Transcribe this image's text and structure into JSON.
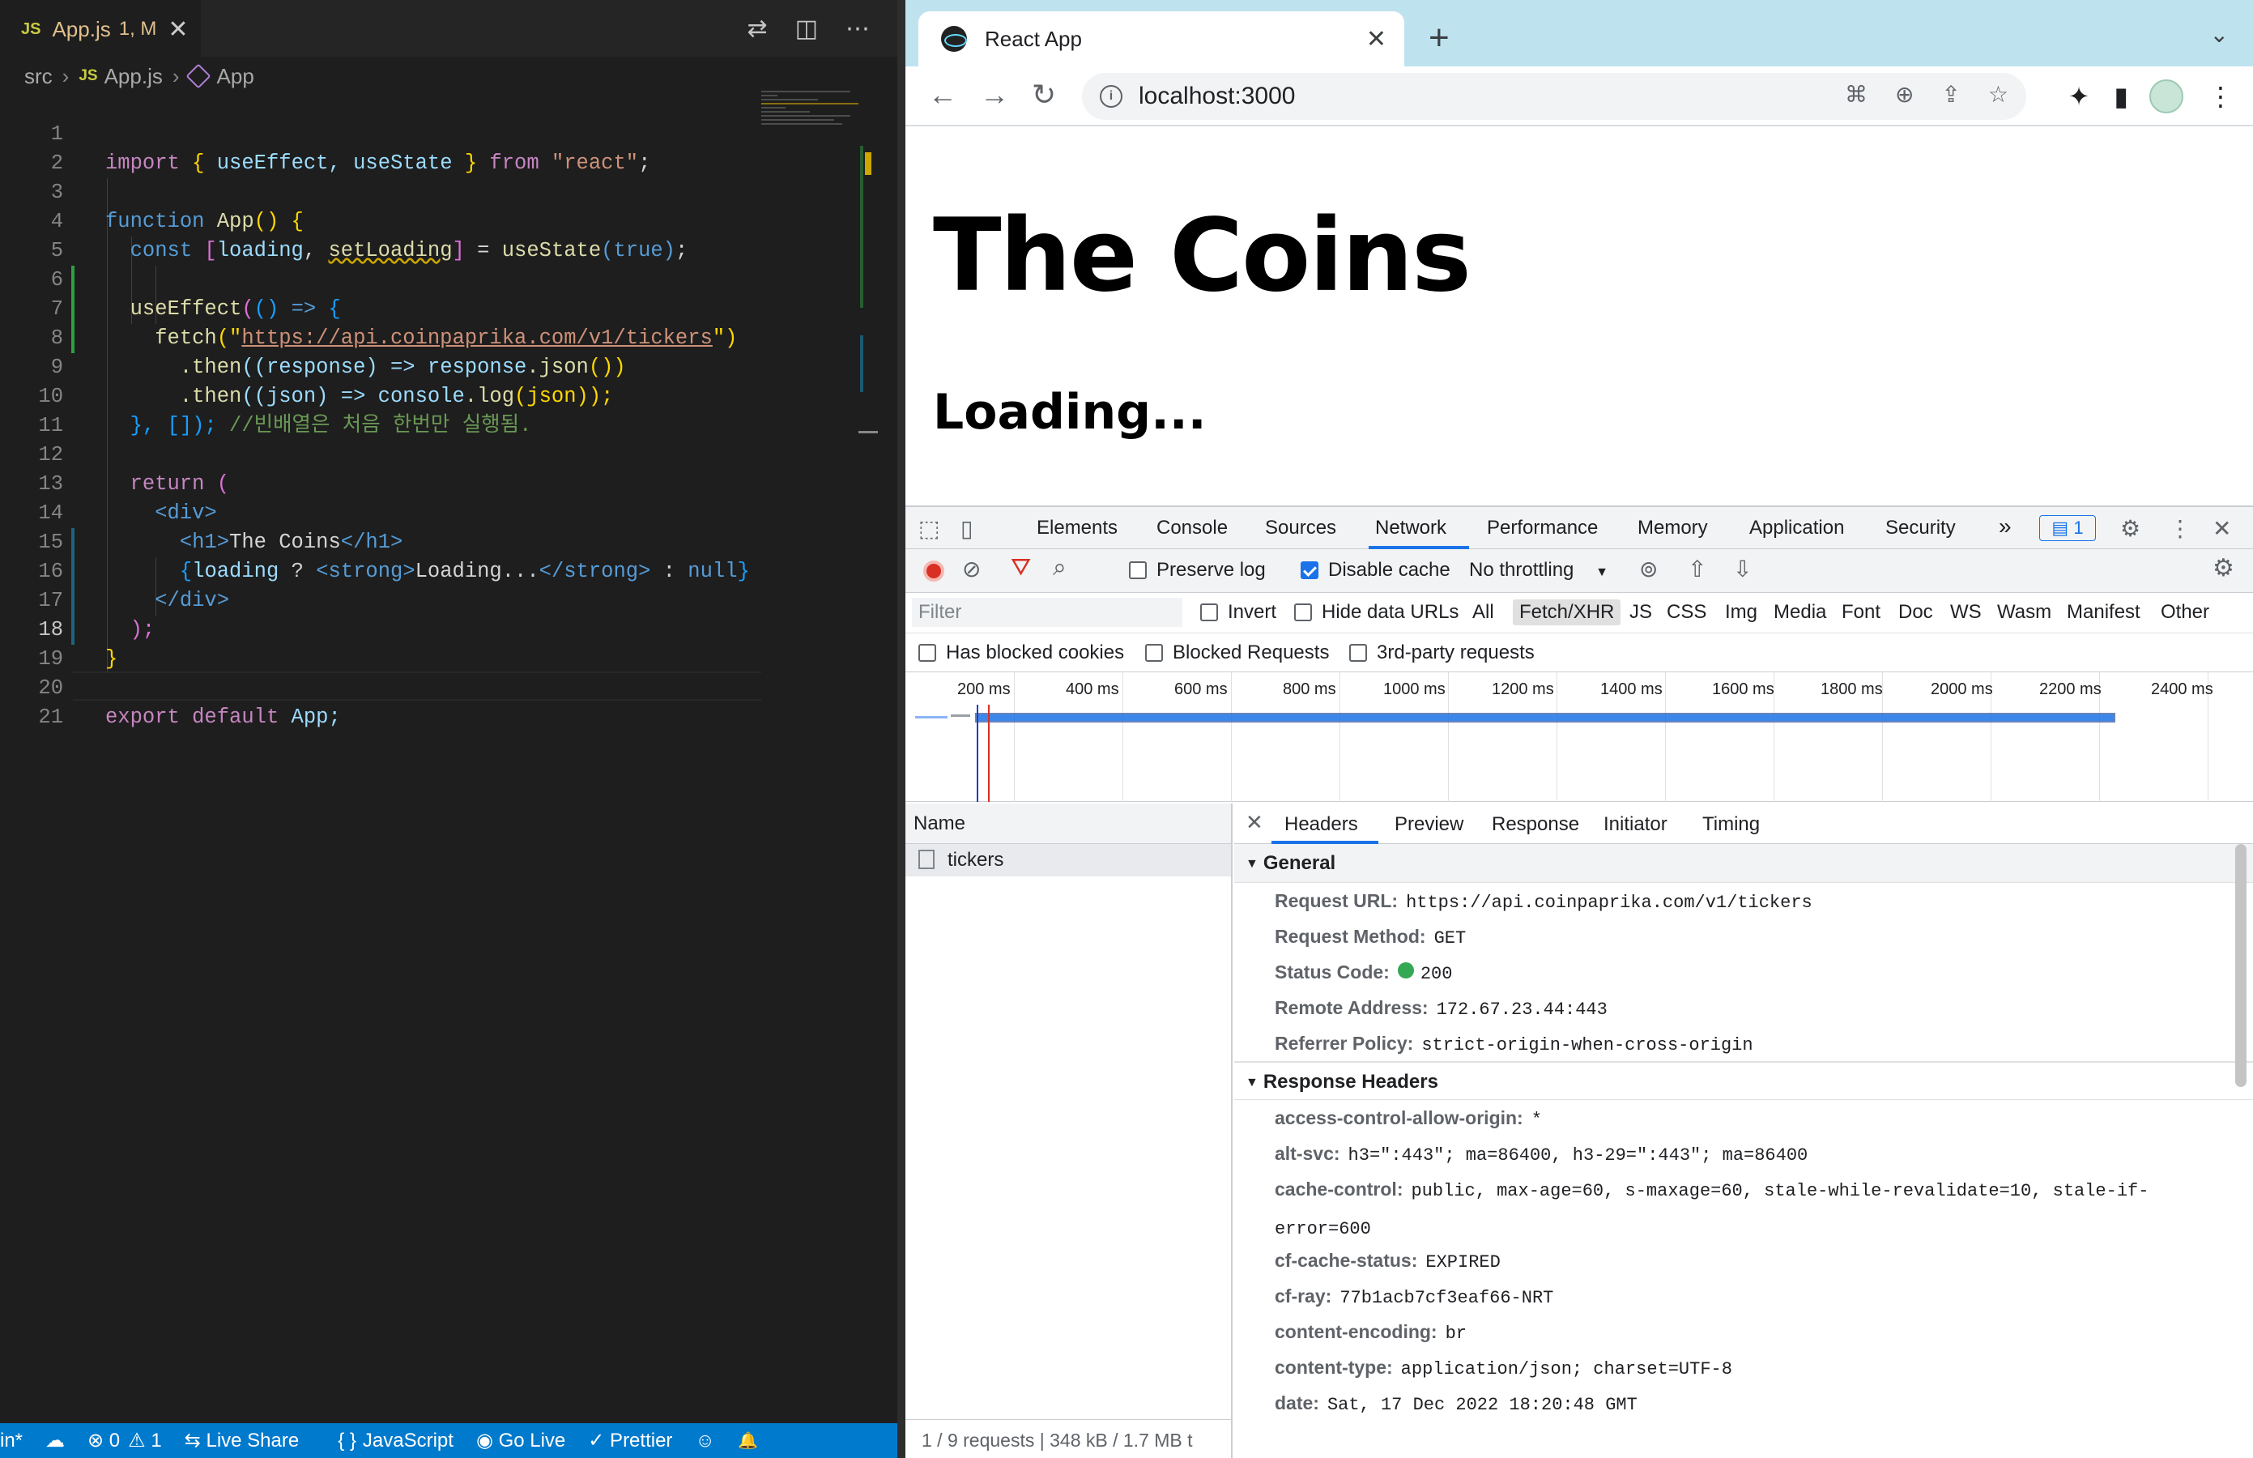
{
  "vscode": {
    "tab": {
      "badge": "JS",
      "title": "App.js",
      "status": "1, M",
      "close": "✕"
    },
    "tab_actions": [
      "⇄",
      "◫",
      "⋯"
    ],
    "breadcrumb": {
      "folder": "src",
      "badge": "JS",
      "file": "App.js",
      "symbol": "App"
    },
    "line_numbers": [
      "1",
      "2",
      "3",
      "4",
      "5",
      "6",
      "7",
      "8",
      "9",
      "10",
      "11",
      "12",
      "13",
      "14",
      "15",
      "16",
      "17",
      "18",
      "19",
      "20",
      "21"
    ],
    "code": {
      "l1_import": "import",
      "l1_open": "{",
      "l1_names": " useEffect, useState ",
      "l1_close": "}",
      "l1_from": " from ",
      "l1_str": "\"react\"",
      "l1_semi": ";",
      "l3_function": "function",
      "l3_name": " App",
      "l3_parens": "()",
      "l3_brace": " {",
      "l4_const": "const",
      "l4_open": " [",
      "l4_loading": "loading",
      "l4_comma": ", ",
      "l4_setLoading": "setLoading",
      "l4_close": "]",
      "l4_eq": " = ",
      "l4_useState": "useState",
      "l4_arg": "(true)",
      "l4_semi": ";",
      "l6_useEffect": "useEffect",
      "l6_open": "(",
      "l6_arrowparens": "()",
      "l6_arrow": " =>",
      "l6_brace": " {",
      "l7_fetch": "fetch",
      "l7_open": "(\"",
      "l7_url": "https://api.coinpaprika.com/v1/tickers",
      "l7_close": "\")",
      "l8_then": ".then",
      "l8_args": "((response) => ",
      "l8_response": "response",
      "l8_json": ".json",
      "l8_close": "())",
      "l9_then": ".then",
      "l9_args": "((json) => ",
      "l9_console": "console",
      "l9_log": ".log",
      "l9_close": "(json));",
      "l10_close": "}, []);",
      "l10_comment": " //빈배열은 처음 한번만 실행됨.",
      "l12_return": "return",
      "l12_paren": " (",
      "l13_div": "<div>",
      "l14_h1open": "<h1>",
      "l14_text": "The Coins",
      "l14_h1close": "</h1>",
      "l15_open": "{",
      "l15_loading": "loading",
      "l15_q": " ? ",
      "l15_strong_open": "<strong>",
      "l15_text": "Loading...",
      "l15_strong_close": "</strong>",
      "l15_colon": " : ",
      "l15_null": "null",
      "l15_close": "}",
      "l16_div_close": "</div>",
      "l17_close": ");",
      "l18_brace": "}",
      "l20_export": "export",
      "l20_default": " default",
      "l20_app": " App;"
    },
    "status": {
      "remote": "in*",
      "sync": "☁",
      "errors": "⊗ 0",
      "warnings": "⚠ 1",
      "liveshare": "⇆ Live Share",
      "braces": "{ }",
      "language": "JavaScript",
      "golive": "◉ Go Live",
      "prettier": "✓ Prettier",
      "feedback": "☺",
      "bell": "🔔"
    }
  },
  "chrome": {
    "tab_title": "React App",
    "tab_close": "✕",
    "new_tab": "+",
    "tab_search": "⌄",
    "nav_back": "←",
    "nav_forward": "→",
    "nav_reload": "↻",
    "url": "localhost:3000",
    "omni_icons": [
      "⌘",
      "⊕",
      "⇪",
      "☆"
    ],
    "toolbar_icons": [
      "✦",
      "▮",
      "⋮"
    ],
    "page": {
      "heading": "The Coins",
      "loading": "Loading..."
    }
  },
  "devtools": {
    "tabs": [
      "Elements",
      "Console",
      "Sources",
      "Network",
      "Performance",
      "Memory",
      "Application",
      "Security"
    ],
    "more": "»",
    "messages": "1",
    "icons": {
      "inspect": "⬚",
      "device": "▯",
      "settings": "⚙",
      "menu": "⋮",
      "close": "✕"
    },
    "network_toolbar": {
      "clear": "⊘",
      "filter": "⛛",
      "search": "⌕",
      "preserve_log": "Preserve log",
      "disable_cache": "Disable cache",
      "throttling": "No throttling",
      "throttle_caret": "▼",
      "wifi": "⊚",
      "upload": "⇧",
      "download": "⇩",
      "gear": "⚙"
    },
    "filter": {
      "placeholder": "Filter",
      "invert": "Invert",
      "hide_data_urls": "Hide data URLs",
      "types": [
        "All",
        "Fetch/XHR",
        "JS",
        "CSS",
        "Img",
        "Media",
        "Font",
        "Doc",
        "WS",
        "Wasm",
        "Manifest",
        "Other"
      ],
      "active_type": "Fetch/XHR"
    },
    "blocked": {
      "has_blocked_cookies": "Has blocked cookies",
      "blocked_requests": "Blocked Requests",
      "third_party": "3rd-party requests"
    },
    "timeline_ticks": [
      "200 ms",
      "400 ms",
      "600 ms",
      "800 ms",
      "1000 ms",
      "1200 ms",
      "1400 ms",
      "1600 ms",
      "1800 ms",
      "2000 ms",
      "2200 ms",
      "2400 ms"
    ],
    "name_header": "Name",
    "requests": [
      "tickers"
    ],
    "net_status": "1 / 9 requests  |  348 kB / 1.7 MB t",
    "detail_tabs": [
      "Headers",
      "Preview",
      "Response",
      "Initiator",
      "Timing"
    ],
    "detail_close": "✕",
    "general": {
      "title": "General",
      "rows": [
        {
          "k": "Request URL:",
          "v": "https://api.coinpaprika.com/v1/tickers"
        },
        {
          "k": "Request Method:",
          "v": "GET"
        },
        {
          "k": "Status Code:",
          "v": "200"
        },
        {
          "k": "Remote Address:",
          "v": "172.67.23.44:443"
        },
        {
          "k": "Referrer Policy:",
          "v": "strict-origin-when-cross-origin"
        }
      ]
    },
    "response_headers": {
      "title": "Response Headers",
      "rows": [
        {
          "k": "access-control-allow-origin:",
          "v": "*"
        },
        {
          "k": "alt-svc:",
          "v": "h3=\":443\"; ma=86400, h3-29=\":443\"; ma=86400"
        },
        {
          "k": "cache-control:",
          "v": "public, max-age=60, s-maxage=60, stale-while-revalidate=10, stale-if-error=600"
        },
        {
          "k": "cf-cache-status:",
          "v": "EXPIRED"
        },
        {
          "k": "cf-ray:",
          "v": "77b1acb7cf3eaf66-NRT"
        },
        {
          "k": "content-encoding:",
          "v": "br"
        },
        {
          "k": "content-type:",
          "v": "application/json; charset=UTF-8"
        },
        {
          "k": "date:",
          "v": "Sat, 17 Dec 2022 18:20:48 GMT"
        }
      ]
    }
  }
}
